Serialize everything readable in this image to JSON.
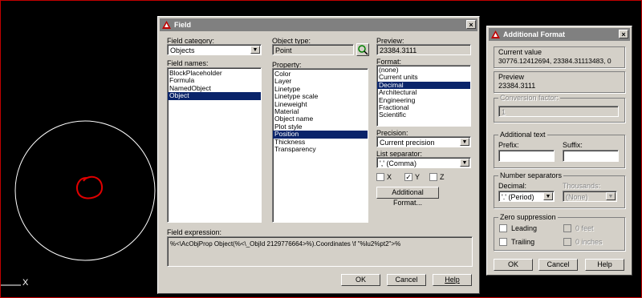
{
  "canvas": {
    "axis_label": "X"
  },
  "field": {
    "title": "Field",
    "category_label": "Field category:",
    "category_value": "Objects",
    "names_label": "Field names:",
    "names": [
      "BlockPlaceholder",
      "Formula",
      "NamedObject",
      "Object"
    ],
    "names_selected": 3,
    "object_type_label": "Object type:",
    "object_type_value": "Point",
    "property_label": "Property:",
    "properties": [
      "Color",
      "Layer",
      "Linetype",
      "Linetype scale",
      "Lineweight",
      "Material",
      "Object name",
      "Plot style",
      "Position",
      "Thickness",
      "Transparency"
    ],
    "properties_selected": 8,
    "preview_label": "Preview:",
    "preview_value": "23384.3111",
    "format_label": "Format:",
    "formats": [
      "(none)",
      "Current units",
      "Decimal",
      "Architectural",
      "Engineering",
      "Fractional",
      "Scientific"
    ],
    "formats_selected": 2,
    "precision_label": "Precision:",
    "precision_value": "Current precision",
    "list_sep_label": "List separator:",
    "list_sep_value": "',' (Comma)",
    "chk_x": "X",
    "chk_y": "Y",
    "chk_z": "Z",
    "chk_y_mark": "✓",
    "additional_button": "Additional Format...",
    "expr_label": "Field expression:",
    "expr_value": "%<\\AcObjProp Object(%<\\_ObjId 2129776664>%).Coordinates \\f \"%lu2%pt2\">%",
    "ok": "OK",
    "cancel": "Cancel",
    "help": "Help",
    "close": "×"
  },
  "additional": {
    "title": "Additional Format",
    "current_label": "Current value",
    "current_value": "30776.12412694, 23384.31113483, 0",
    "preview_label": "Preview",
    "preview_value": "23384.3111",
    "conv_label": "Conversion factor:",
    "conv_value": "1",
    "addtext_label": "Additional text",
    "prefix_label": "Prefix:",
    "suffix_label": "Suffix:",
    "numsep_label": "Number separators",
    "decimal_label": "Decimal:",
    "decimal_value": "'.' (Period)",
    "thousands_label": "Thousands:",
    "thousands_value": "(None)",
    "zero_label": "Zero suppression",
    "leading": "Leading",
    "trailing": "Trailing",
    "feet": "0 feet",
    "inches": "0 inches",
    "ok": "OK",
    "cancel": "Cancel",
    "help": "Help",
    "close": "×"
  }
}
